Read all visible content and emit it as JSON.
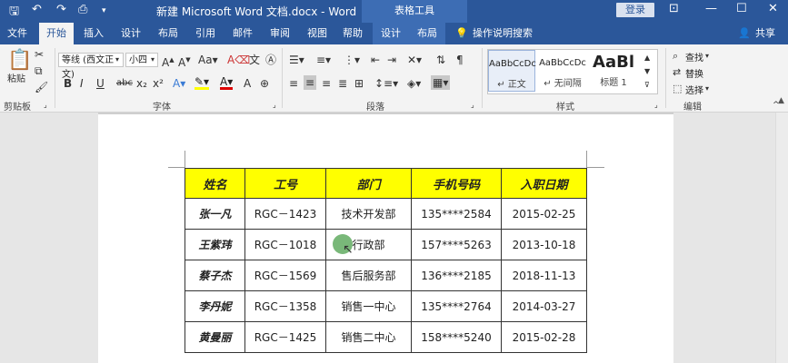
{
  "titlebar": {
    "doc_title": "新建 Microsoft Word 文档.docx - Word",
    "tool_title": "表格工具",
    "login": "登录",
    "icons": [
      "save-icon",
      "undo-icon",
      "redo-icon",
      "print-preview-icon",
      "customize-icon"
    ]
  },
  "tabs": [
    "文件",
    "开始",
    "插入",
    "设计",
    "布局",
    "引用",
    "邮件",
    "审阅",
    "视图",
    "帮助",
    "设计",
    "布局"
  ],
  "tell_me": "操作说明搜索",
  "share": "共享",
  "clipboard": {
    "paste": "粘贴",
    "label": "剪贴板"
  },
  "font": {
    "name": "等线 (西文正文)",
    "size": "小四",
    "label": "字体",
    "bold": "B",
    "italic": "I",
    "underline": "U",
    "strike": "abc",
    "sub": "x₂",
    "sup": "x²"
  },
  "paragraph": {
    "label": "段落"
  },
  "styles": {
    "label": "样式",
    "items": [
      {
        "sample": "AaBbCcDc",
        "name": "↵ 正文"
      },
      {
        "sample": "AaBbCcDc",
        "name": "↵ 无间隔"
      },
      {
        "sample": "AaBl",
        "name": "标题 1"
      }
    ]
  },
  "editing": {
    "label": "编辑",
    "find": "查找",
    "replace": "替换",
    "select": "选择"
  },
  "table": {
    "headers": [
      "姓名",
      "工号",
      "部门",
      "手机号码",
      "入职日期"
    ],
    "rows": [
      [
        "张一凡",
        "RGC－1423",
        "技术开发部",
        "135****2584",
        "2015-02-25"
      ],
      [
        "王紫玮",
        "RGC－1018",
        "行政部",
        "157****5263",
        "2013-10-18"
      ],
      [
        "蔡子杰",
        "RGC－1569",
        "售后服务部",
        "136****2185",
        "2018-11-13"
      ],
      [
        "李丹妮",
        "RGC－1358",
        "销售一中心",
        "135****2764",
        "2014-03-27"
      ],
      [
        "黄曼丽",
        "RGC－1425",
        "销售二中心",
        "158****5240",
        "2015-02-28"
      ]
    ],
    "header_color": "#ffff00"
  },
  "colors": {
    "accent": "#2b579a"
  }
}
